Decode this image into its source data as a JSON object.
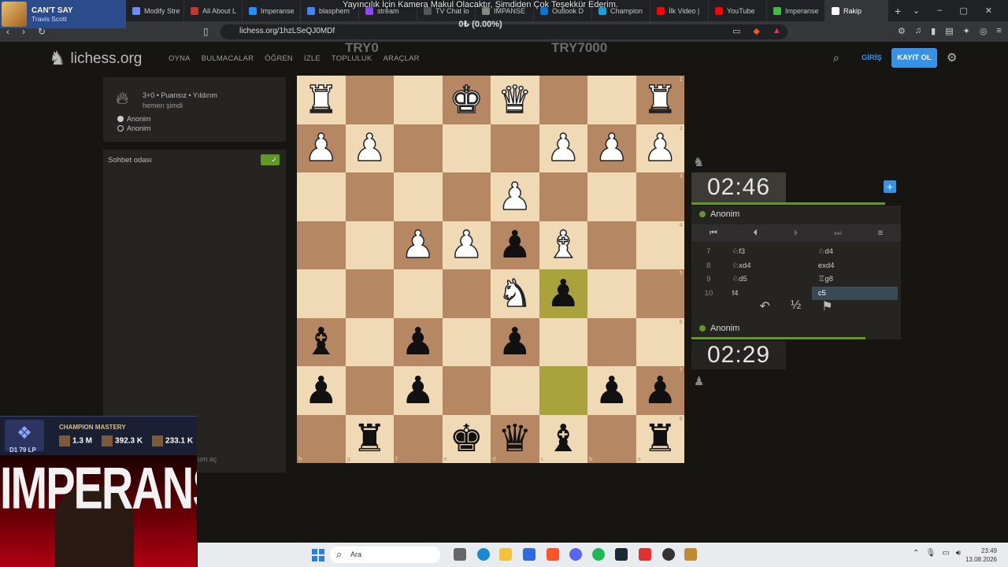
{
  "browser": {
    "tabs": [
      {
        "label": "Modify Stre",
        "color": "#6b8cff"
      },
      {
        "label": "All About L",
        "color": "#c0392b"
      },
      {
        "label": "Imperanse",
        "color": "#1e90ff"
      },
      {
        "label": "blasphem",
        "color": "#4285f4"
      },
      {
        "label": "stream",
        "color": "#9146ff"
      },
      {
        "label": "TV Chat lo",
        "color": "#555"
      },
      {
        "label": "IMPANSE",
        "color": "#888"
      },
      {
        "label": "Outlook D",
        "color": "#0078d4"
      },
      {
        "label": "Champion",
        "color": "#19a3d8"
      },
      {
        "label": "İlk Video |",
        "color": "#ff0000"
      },
      {
        "label": "YouTube",
        "color": "#ff0000"
      },
      {
        "label": "Imperanse",
        "color": "#3fbf3f"
      },
      {
        "label": "Rakip",
        "color": "#ffffff"
      }
    ],
    "url": "lichess.org/1hzLSeQJ0MDf"
  },
  "overlay": {
    "now_playing_title": "CAN'T SAY",
    "now_playing_artist": "Travis Scott",
    "banner": "Yayıncılık İçin Kamera Makul Olacaktır, Şimdiden Çok Teşekkür Ederim.",
    "donation": "0₺ (0.00%)",
    "goal_left": "TRY0",
    "goal_right": "TRY7000",
    "mastery_title": "CHAMPION MASTERY",
    "mastery_rank": "D1 79 LP",
    "mastery_stats": [
      "1.3 M",
      "392.3 K",
      "233.1 K"
    ],
    "cam_name": "IMPERANSE"
  },
  "header": {
    "logo": "lichess.org",
    "nav": [
      "OYNA",
      "BULMACALAR",
      "ÖĞREN",
      "İZLE",
      "TOPLULUK",
      "ARAÇLAR"
    ],
    "login": "GİRİŞ",
    "signup": "KAYIT OL"
  },
  "game": {
    "meta": "3+0 • Puansız • Yıldırım",
    "time": "hemen şimdi",
    "players": [
      {
        "name": "Anonim",
        "color": "#ffffff"
      },
      {
        "name": "Anonim",
        "color": "#262421"
      }
    ]
  },
  "chat": {
    "title": "Sohbet odası",
    "hint": "um aç"
  },
  "board": {
    "files_bottom": [
      "h",
      "g",
      "f",
      "e",
      "d",
      "c",
      "b",
      "a"
    ],
    "ranks_right": [
      "1",
      "2",
      "3",
      "4",
      "5",
      "6",
      "7",
      "8"
    ],
    "rows": [
      [
        "♜",
        "",
        "",
        "♚",
        "♛",
        "",
        "",
        "♜"
      ],
      [
        "♟",
        "♟",
        "",
        "",
        "",
        "♟",
        "♟",
        "♟"
      ],
      [
        "",
        "",
        "",
        "",
        "♟",
        "",
        "",
        ""
      ],
      [
        "",
        "",
        "♟",
        "♟",
        "♟",
        "♝",
        "",
        ""
      ],
      [
        "",
        "",
        "",
        "",
        "♞",
        "♟",
        "",
        ""
      ],
      [
        "♝",
        "",
        "♟",
        "",
        "♟",
        "",
        "",
        ""
      ],
      [
        "♟",
        "",
        "♟",
        "",
        "",
        "",
        "♟",
        "♟"
      ],
      [
        "",
        "♜",
        "",
        "♚",
        "♛",
        "♝",
        "",
        "♜"
      ]
    ],
    "white_mask": [
      [
        1,
        0,
        0,
        1,
        1,
        0,
        0,
        1
      ],
      [
        1,
        1,
        0,
        0,
        0,
        1,
        1,
        1
      ],
      [
        0,
        0,
        0,
        0,
        1,
        0,
        0,
        0
      ],
      [
        0,
        0,
        1,
        1,
        0,
        1,
        0,
        0
      ],
      [
        0,
        0,
        0,
        0,
        1,
        0,
        0,
        0
      ],
      [
        0,
        0,
        0,
        0,
        0,
        0,
        0,
        0
      ],
      [
        0,
        0,
        0,
        0,
        0,
        0,
        0,
        0
      ],
      [
        0,
        0,
        0,
        0,
        0,
        0,
        0,
        0
      ]
    ],
    "highlight": [
      [
        4,
        5
      ],
      [
        6,
        5
      ]
    ]
  },
  "clocks": {
    "opponent": "02:46",
    "player": "02:29",
    "opponent_name": "Anonim",
    "player_name": "Anonim"
  },
  "moves": [
    {
      "n": "7",
      "w": "♘f3",
      "b": "♘d4"
    },
    {
      "n": "8",
      "w": "♘xd4",
      "b": "exd4"
    },
    {
      "n": "9",
      "w": "♘d5",
      "b": "♖g8"
    },
    {
      "n": "10",
      "w": "f4",
      "b": "c5"
    }
  ],
  "taskbar": {
    "search": "Ara",
    "time": "23:49",
    "date": "13.08.2026"
  }
}
